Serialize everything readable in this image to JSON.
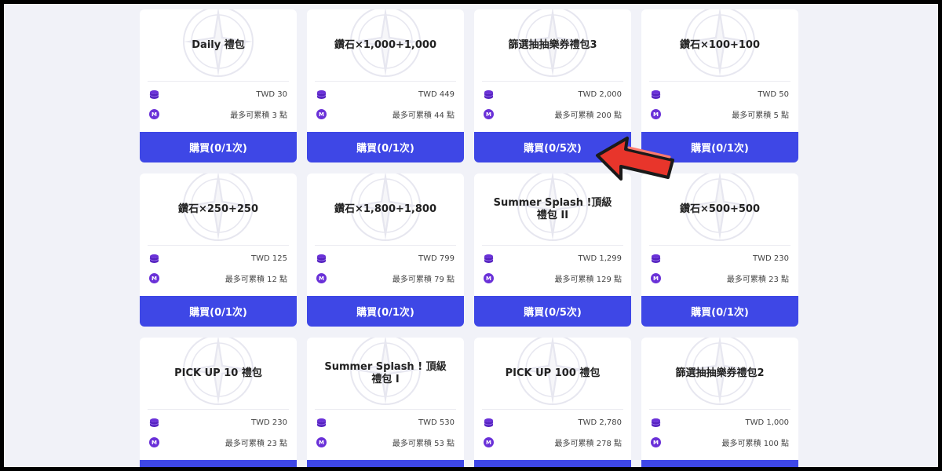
{
  "icons": {
    "coin": "coin-stack-icon",
    "points": "m-points-icon"
  },
  "colors": {
    "accent": "#3e47e6",
    "points_badge": "#6a31d8",
    "arrow": "#e8352b",
    "background": "#f1f2f8"
  },
  "points_badge_letter": "M",
  "products": [
    {
      "title": "Daily 禮包",
      "price": "TWD 30",
      "points": "最多可累積 3 點",
      "buy_label": "購買(0/1次)"
    },
    {
      "title": "鑽石×1,000+1,000",
      "price": "TWD 449",
      "points": "最多可累積 44 點",
      "buy_label": "購買(0/1次)"
    },
    {
      "title": "篩選抽抽樂券禮包3",
      "price": "TWD 2,000",
      "points": "最多可累積 200 點",
      "buy_label": "購買(0/5次)"
    },
    {
      "title": "鑽石×100+100",
      "price": "TWD 50",
      "points": "最多可累積 5 點",
      "buy_label": "購買(0/1次)"
    },
    {
      "title": "鑽石×250+250",
      "price": "TWD 125",
      "points": "最多可累積 12 點",
      "buy_label": "購買(0/1次)"
    },
    {
      "title": "鑽石×1,800+1,800",
      "price": "TWD 799",
      "points": "最多可累積 79 點",
      "buy_label": "購買(0/1次)"
    },
    {
      "title": "Summer Splash !頂級禮包 II",
      "price": "TWD 1,299",
      "points": "最多可累積 129 點",
      "buy_label": "購買(0/5次)"
    },
    {
      "title": "鑽石×500+500",
      "price": "TWD 230",
      "points": "最多可累積 23 點",
      "buy_label": "購買(0/1次)"
    },
    {
      "title": "PICK UP 10 禮包",
      "price": "TWD 230",
      "points": "最多可累積 23 點",
      "buy_label": ""
    },
    {
      "title": "Summer Splash ! 頂級禮包 I",
      "price": "TWD 530",
      "points": "最多可累積 53 點",
      "buy_label": ""
    },
    {
      "title": "PICK UP 100 禮包",
      "price": "TWD 2,780",
      "points": "最多可累積 278 點",
      "buy_label": ""
    },
    {
      "title": "篩選抽抽樂券禮包2",
      "price": "TWD 1,000",
      "points": "最多可累積 100 點",
      "buy_label": ""
    }
  ]
}
